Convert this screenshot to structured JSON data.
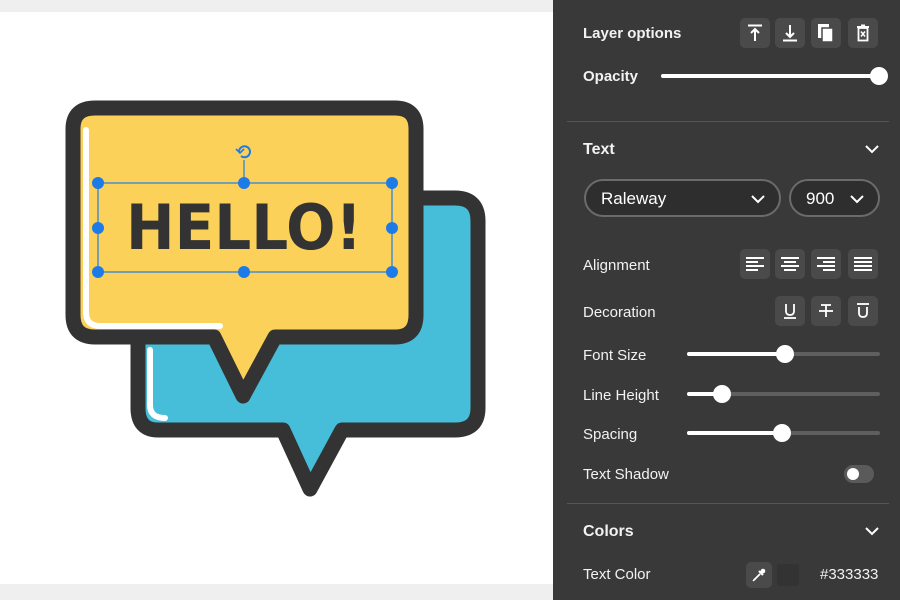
{
  "canvas": {
    "artwork_text": "HELLO!",
    "colors": {
      "outline": "#333333",
      "yellow_bubble": "#FCD15A",
      "blue_bubble": "#47BED9",
      "selection": "#1D7BE8"
    },
    "selection_handles": [
      "rotate-handle",
      "corner-handles",
      "edge-handles"
    ]
  },
  "panel": {
    "layer_options": {
      "title": "Layer options",
      "buttons": [
        "bring-to-front-icon",
        "send-to-back-icon",
        "duplicate-icon",
        "delete-icon"
      ]
    },
    "opacity": {
      "label": "Opacity",
      "value": 1.0
    },
    "text_section": {
      "title": "Text",
      "font_family": "Raleway",
      "font_weight": "900",
      "alignment_label": "Alignment",
      "alignment_options": [
        "align-left-icon",
        "align-center-icon",
        "align-right-icon",
        "align-justify-icon"
      ],
      "decoration_label": "Decoration",
      "decoration_options": [
        "underline-icon",
        "strikethrough-icon",
        "overline-icon"
      ],
      "font_size": {
        "label": "Font Size",
        "value": 0.5
      },
      "line_height": {
        "label": "Line Height",
        "value": 0.18
      },
      "spacing": {
        "label": "Spacing",
        "value": 0.49
      },
      "text_shadow": {
        "label": "Text Shadow",
        "enabled": false
      }
    },
    "colors_section": {
      "title": "Colors",
      "text_color_label": "Text Color",
      "text_color_value": "#333333"
    }
  }
}
